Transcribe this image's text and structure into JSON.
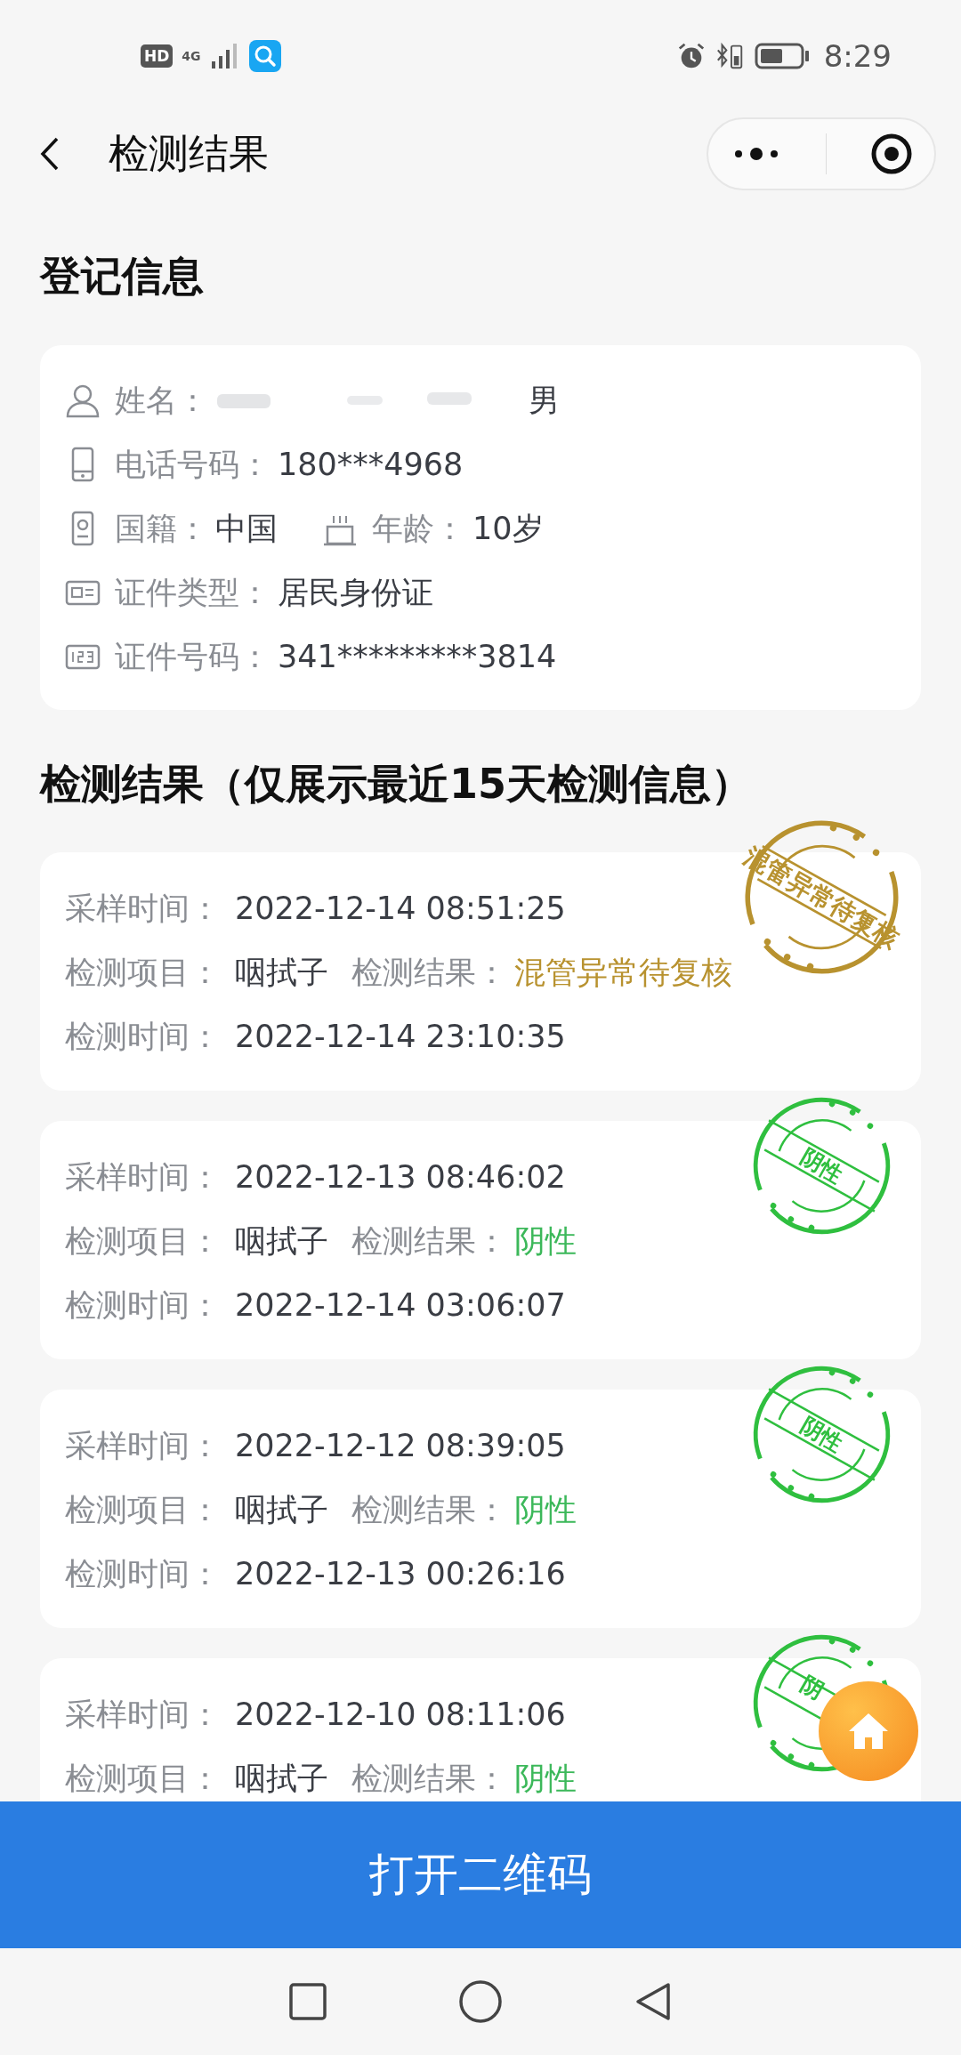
{
  "status_bar": {
    "badges": [
      "HD",
      "4G"
    ],
    "time": "8:29"
  },
  "header": {
    "title": "检测结果"
  },
  "registration": {
    "title": "登记信息",
    "rows": [
      {
        "items": [
          {
            "kind": "person",
            "label": "姓名：",
            "value": "男",
            "redacted": true
          }
        ]
      },
      {
        "items": [
          {
            "kind": "phone",
            "label": "电话号码：",
            "value": "180***4968"
          }
        ]
      },
      {
        "items": [
          {
            "kind": "nationality",
            "label": "国籍：",
            "value": "中国"
          },
          {
            "kind": "age",
            "label": "年龄：",
            "value": "10岁"
          }
        ]
      },
      {
        "items": [
          {
            "kind": "id_type",
            "label": "证件类型：",
            "value": "居民身份证"
          }
        ]
      },
      {
        "items": [
          {
            "kind": "id_number",
            "label": "证件号码：",
            "value": "341*********3814"
          }
        ]
      }
    ]
  },
  "results": {
    "title": "检测结果（仅展示最近15天检测信息）",
    "records": [
      {
        "kind": "abnormal",
        "stamp": "混管异常待复核",
        "rows": [
          {
            "label": "采样时间：",
            "value": "2022-12-14 08:51:25"
          },
          {
            "label": "检测项目：",
            "value": "咽拭子",
            "result_label": "检测结果：",
            "result": "混管异常待复核"
          },
          {
            "label": "检测时间：",
            "value": "2022-12-14 23:10:35"
          }
        ]
      },
      {
        "kind": "negative",
        "stamp": "阴性",
        "rows": [
          {
            "label": "采样时间：",
            "value": "2022-12-13 08:46:02"
          },
          {
            "label": "检测项目：",
            "value": "咽拭子",
            "result_label": "检测结果：",
            "result": "阴性"
          },
          {
            "label": "检测时间：",
            "value": "2022-12-14 03:06:07"
          }
        ]
      },
      {
        "kind": "negative",
        "stamp": "阴性",
        "rows": [
          {
            "label": "采样时间：",
            "value": "2022-12-12 08:39:05"
          },
          {
            "label": "检测项目：",
            "value": "咽拭子",
            "result_label": "检测结果：",
            "result": "阴性"
          },
          {
            "label": "检测时间：",
            "value": "2022-12-13 00:26:16"
          }
        ]
      },
      {
        "kind": "negative",
        "stamp": "阴",
        "rows": [
          {
            "label": "采样时间：",
            "value": "2022-12-10 08:11:06"
          },
          {
            "label": "检测项目：",
            "value": "咽拭子",
            "result_label": "检测结果：",
            "result": "阴性"
          }
        ]
      }
    ]
  },
  "action_button": {
    "label": "打开二维码"
  }
}
